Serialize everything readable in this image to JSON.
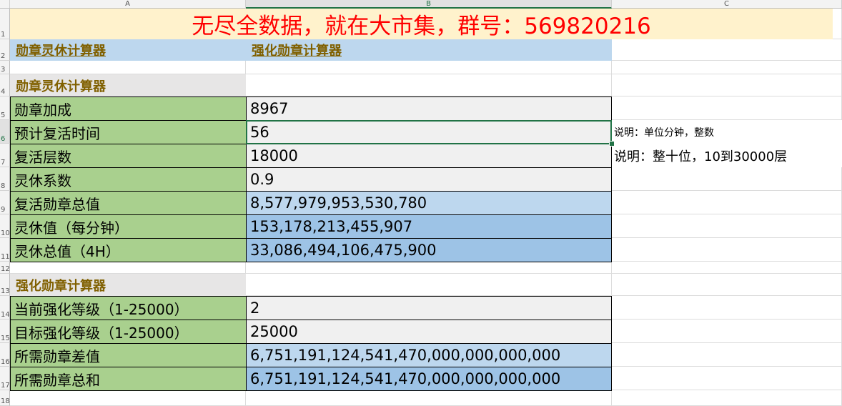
{
  "columns": [
    "A",
    "B",
    "C"
  ],
  "rows": [
    "1",
    "2",
    "3",
    "4",
    "5",
    "6",
    "7",
    "8",
    "9",
    "10",
    "11",
    "12",
    "13",
    "14",
    "15",
    "16",
    "17",
    "18"
  ],
  "banner": "无尽全数据，就在大市集，群号：569820216",
  "links": {
    "medal_calc": "勋章灵休计算器",
    "enhance_calc": "强化勋章计算器"
  },
  "section1": {
    "title": "勋章灵休计算器",
    "items": [
      {
        "label": "勋章加成",
        "value": "8967"
      },
      {
        "label": "预计复活时间",
        "value": "56"
      },
      {
        "label": "复活层数",
        "value": "18000"
      },
      {
        "label": "灵休系数",
        "value": "0.9"
      },
      {
        "label": "复活勋章总值",
        "value": "8,577,979,953,530,780"
      },
      {
        "label": "灵休值（每分钟）",
        "value": "153,178,213,455,907"
      },
      {
        "label": "灵休总值（4H）",
        "value": "33,086,494,106,475,900"
      }
    ]
  },
  "notes": {
    "revive_time": "说明：单位分钟，整数",
    "revive_layers": "说明：整十位，10到30000层"
  },
  "section2": {
    "title": "强化勋章计算器",
    "items": [
      {
        "label": "当前强化等级（1-25000）",
        "value": "2"
      },
      {
        "label": "目标强化等级（1-25000）",
        "value": "25000"
      },
      {
        "label": "所需勋章差值",
        "value": "6,751,191,124,541,470,000,000,000,000"
      },
      {
        "label": "所需勋章总和",
        "value": "6,751,191,124,541,470,000,000,000,000"
      }
    ]
  }
}
